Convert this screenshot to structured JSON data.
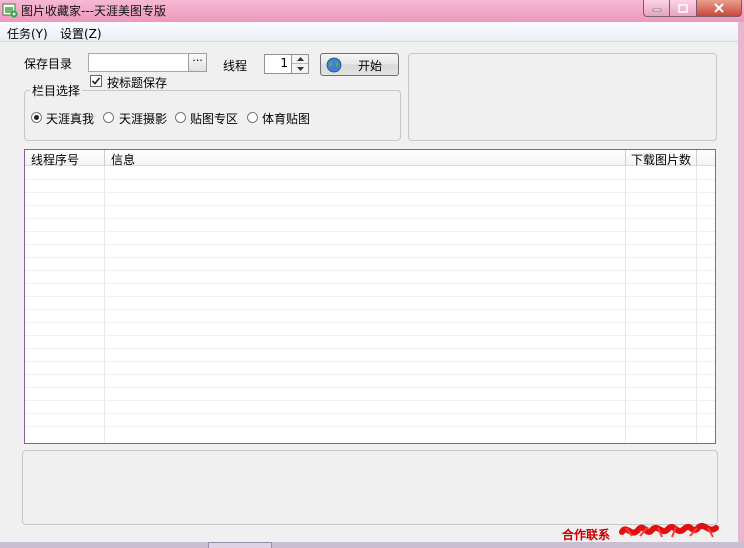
{
  "window": {
    "title": "图片收藏家---天涯美图专版",
    "icons": {
      "app": "app-image-icon",
      "minimize": "minimize-icon",
      "maximize": "maximize-icon",
      "close": "close-icon"
    }
  },
  "menu": {
    "items": [
      {
        "label": "任务(Y)"
      },
      {
        "label": "设置(Z)"
      }
    ]
  },
  "form": {
    "save_dir_label": "保存目录",
    "save_dir_value": "",
    "browse_label": "···",
    "title_save_checkbox_label": "按标题保存",
    "title_save_checked": true,
    "thread_label": "线程",
    "thread_value": "1",
    "start_button_label": "开始",
    "start_icon": "globe-icon"
  },
  "section_group": {
    "title": "栏目选择",
    "options": [
      {
        "label": "天涯真我",
        "selected": true
      },
      {
        "label": "天涯摄影",
        "selected": false
      },
      {
        "label": "贴图专区",
        "selected": false
      },
      {
        "label": "体育贴图",
        "selected": false
      }
    ]
  },
  "table": {
    "columns": [
      "线程序号",
      "信息",
      "下载图片数"
    ],
    "rows": []
  },
  "footer": {
    "contact_label": "合作联系"
  },
  "colors": {
    "titlebar": "#ee97bd",
    "client_bg": "#f0f0f0",
    "list_border": "#8c5fa0",
    "contact_text": "#cc0000"
  }
}
